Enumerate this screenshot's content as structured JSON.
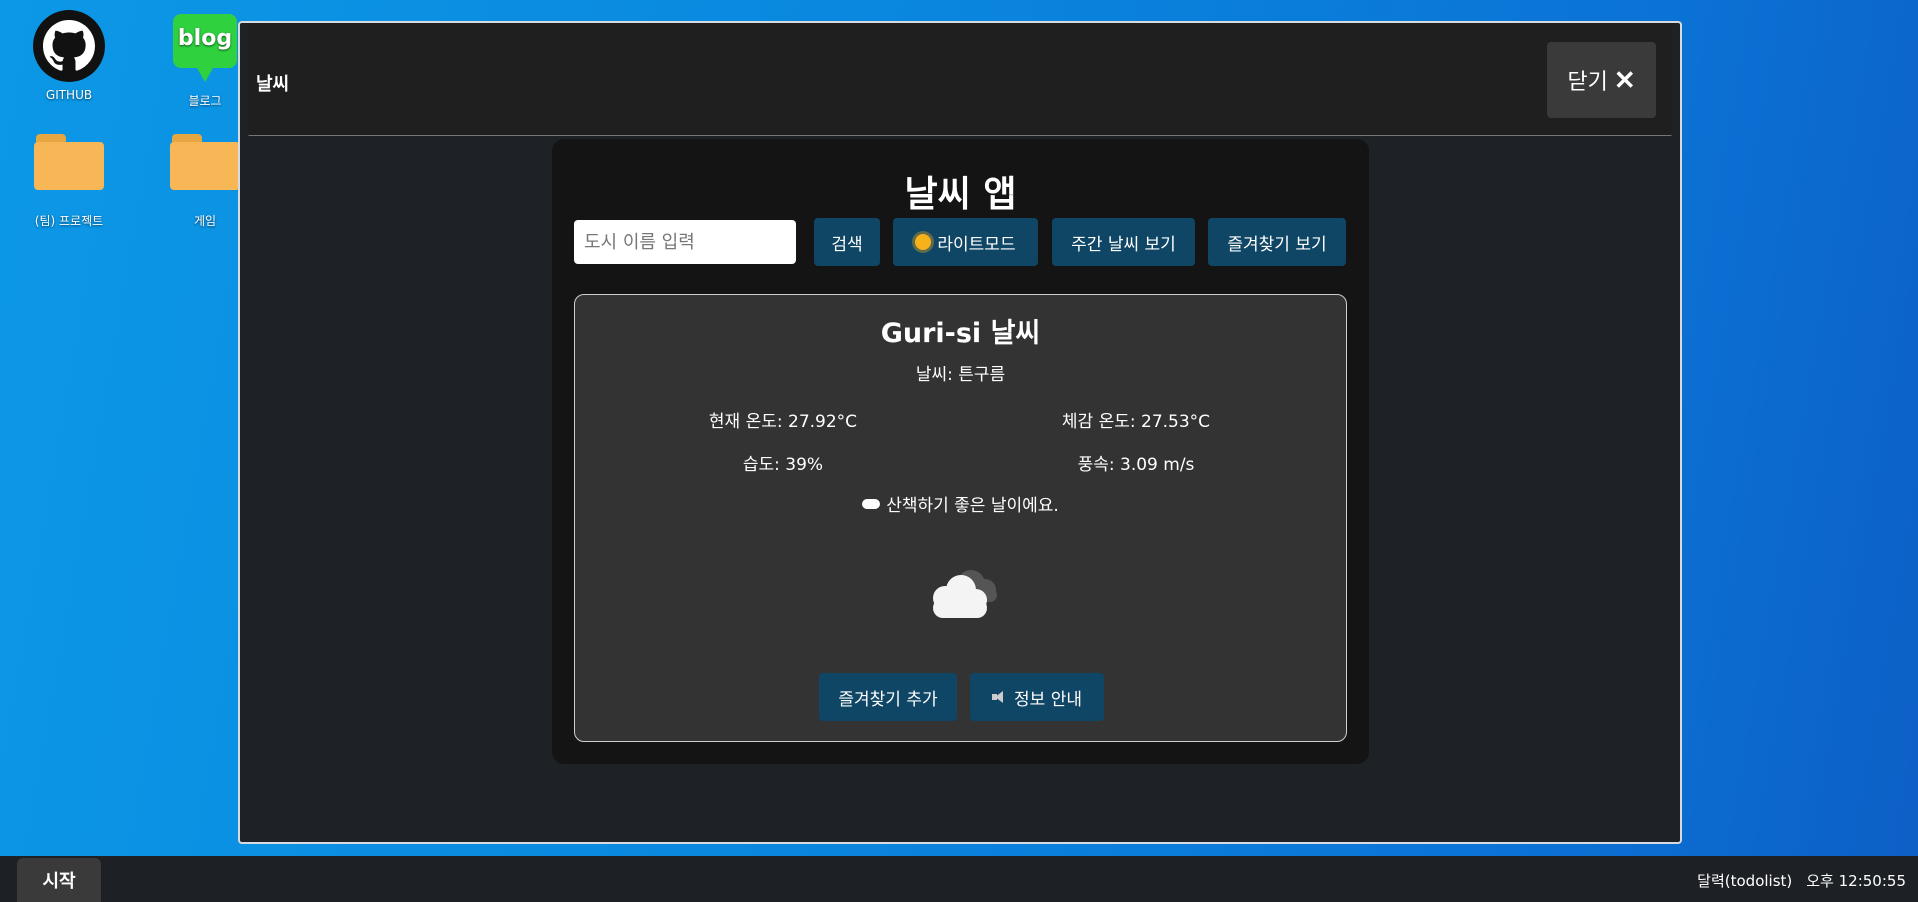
{
  "desktop": {
    "icons": [
      {
        "label": "GITHUB"
      },
      {
        "label": "블로그",
        "badge": "blog"
      },
      {
        "label": "(팀) 프로젝트"
      },
      {
        "label": "게임"
      }
    ]
  },
  "window": {
    "title": "날씨",
    "close_label": "닫기",
    "close_icon": "close-icon"
  },
  "app": {
    "title": "날씨 앱",
    "search": {
      "placeholder": "도시 이름 입력",
      "value": ""
    },
    "buttons": {
      "search": "검색",
      "theme": "라이트모드",
      "weekly": "주간 날씨 보기",
      "favorites_view": "즐겨찾기 보기"
    },
    "card": {
      "city_title": "Guri-si 날씨",
      "description": "날씨: 튼구름",
      "current_temp": "현재 온도: 27.92°C",
      "feels_like": "체감 온도: 27.53°C",
      "humidity": "습도: 39%",
      "wind": "풍속: 3.09 m/s",
      "message": "산책하기 좋은 날이에요.",
      "weather_icon": "broken-clouds-icon",
      "buttons": {
        "add_favorite": "즐겨찾기 추가",
        "info": "정보 안내"
      }
    }
  },
  "taskbar": {
    "start_label": "시작",
    "app_name": "달력(todolist)",
    "clock": "오후 12:50:55"
  }
}
